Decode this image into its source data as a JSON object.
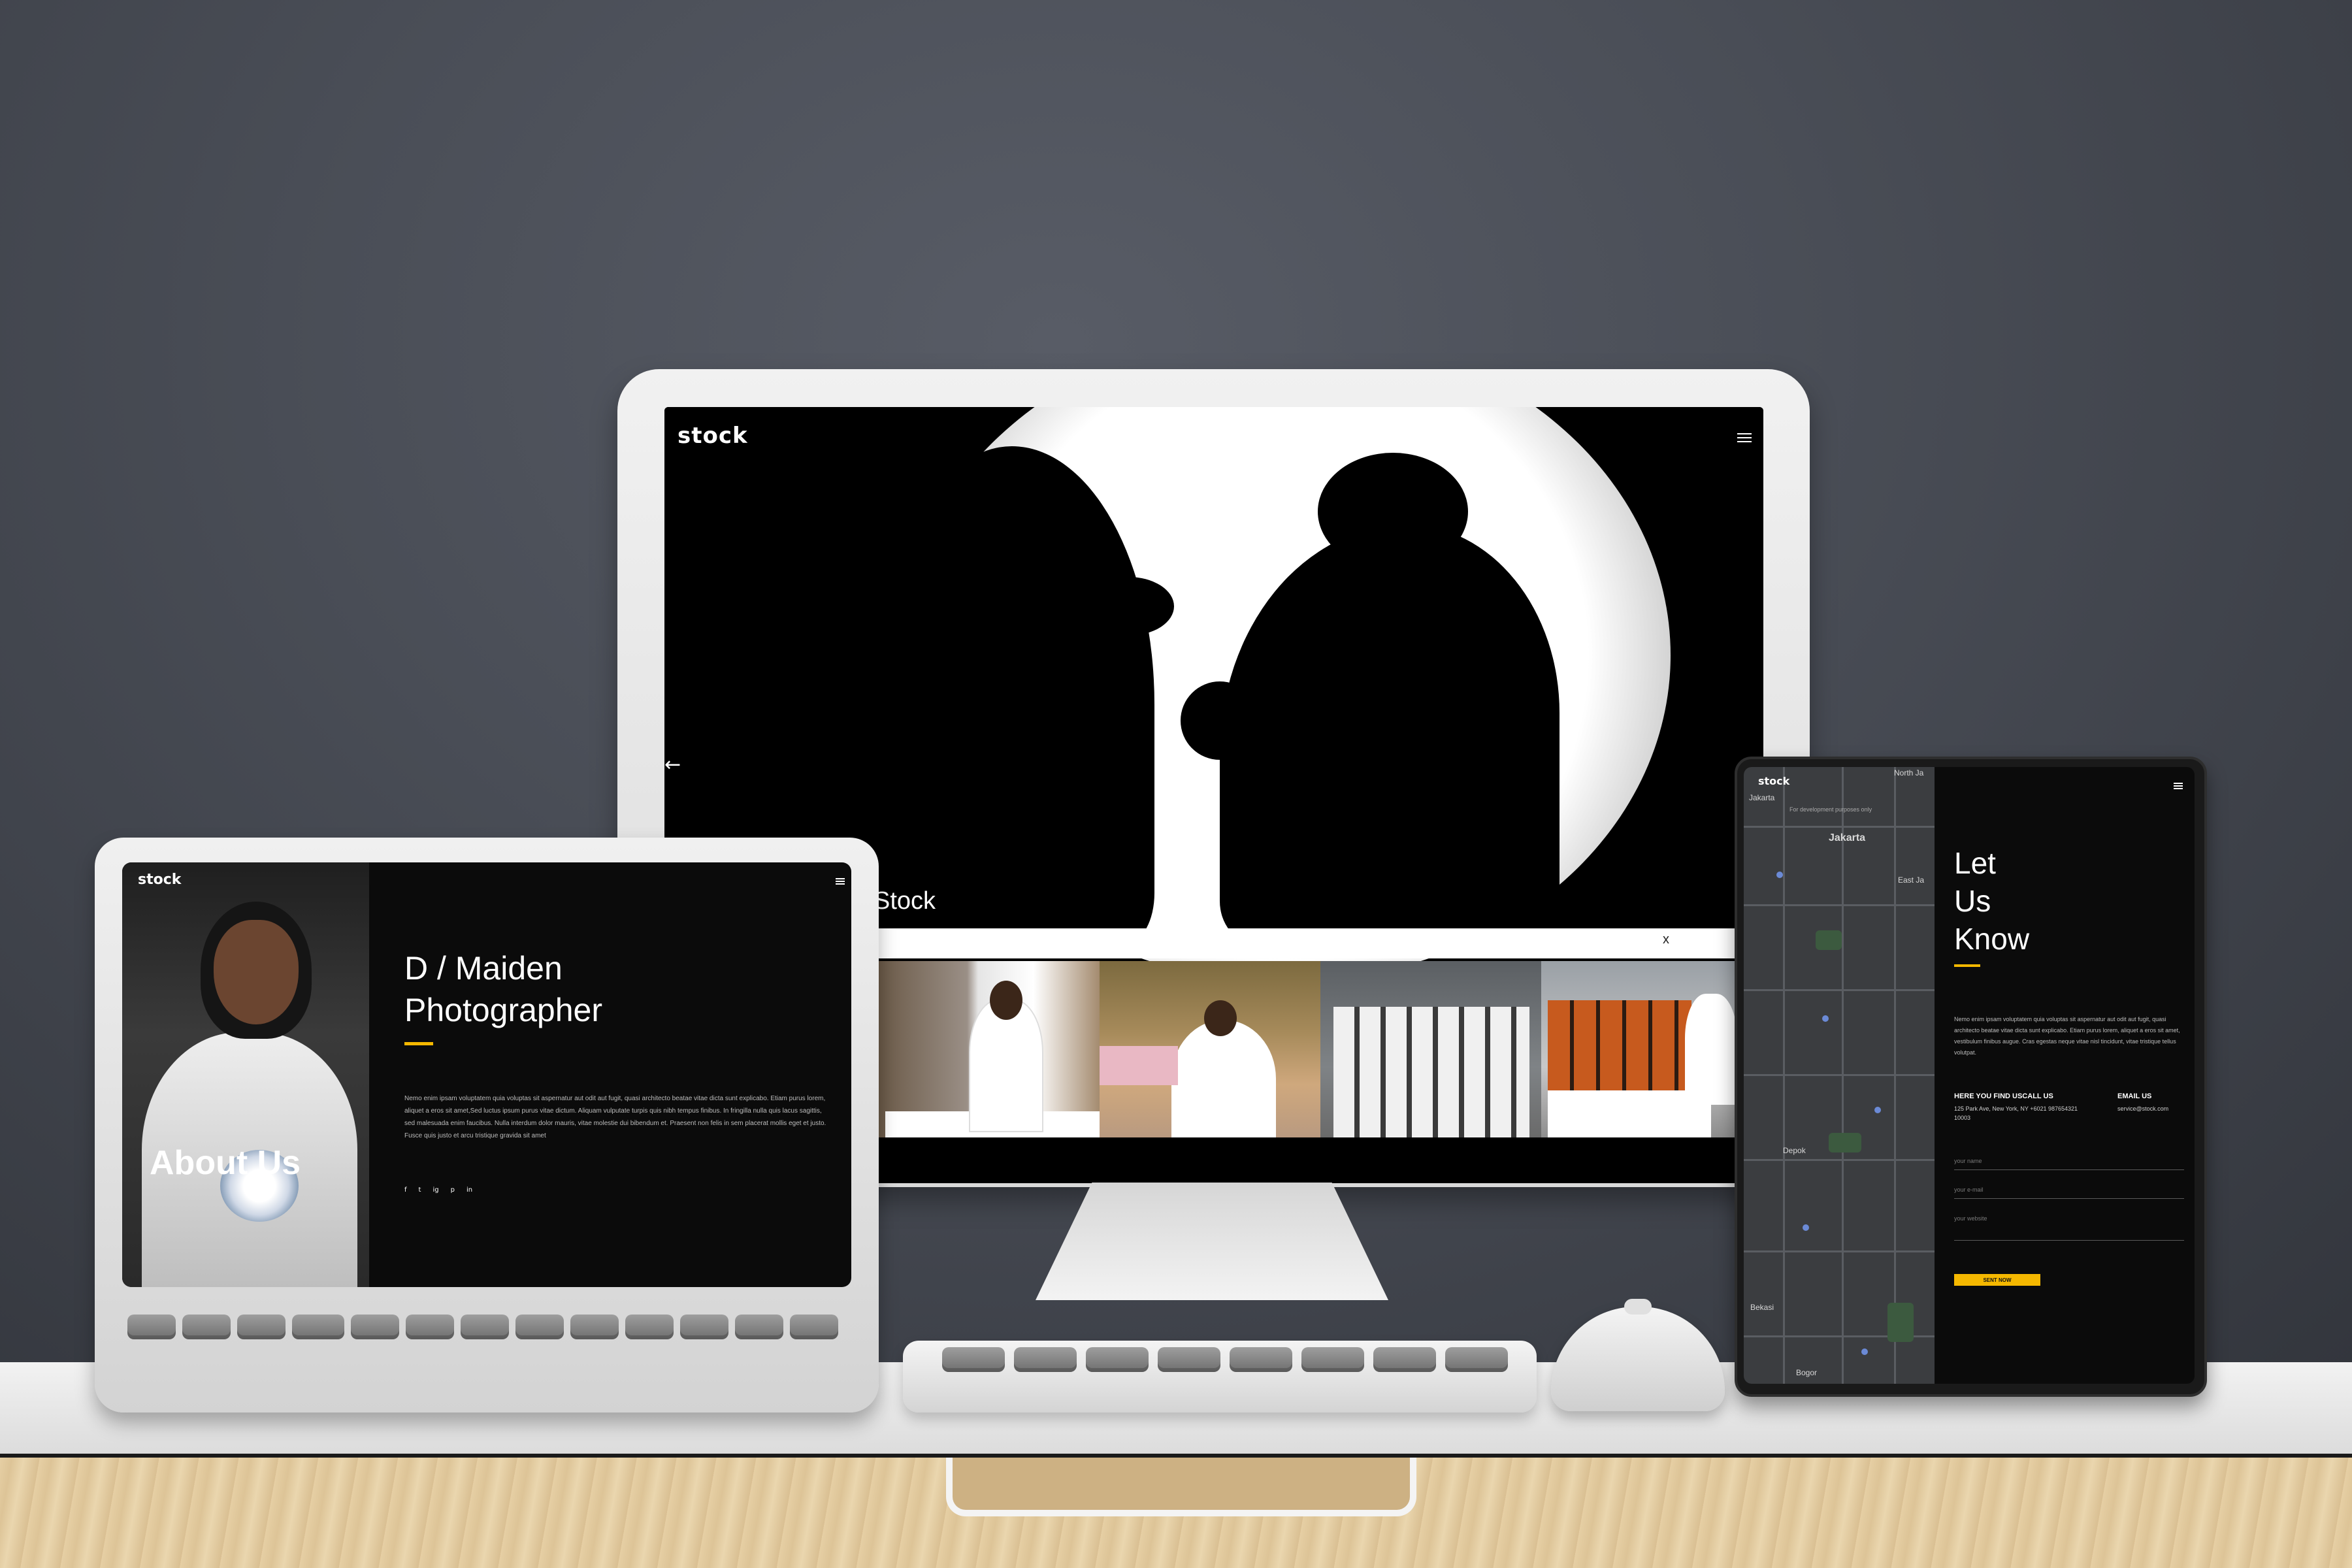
{
  "monitor": {
    "logo": "stock",
    "hero_brand": "Stock",
    "gallery_close": "x",
    "prev_arrow": "←",
    "menu_icon": "hamburger-icon"
  },
  "laptop": {
    "logo": "stock",
    "about_title": "About Us",
    "heading_line1": "D / Maiden",
    "heading_line2": "Photographer",
    "body": "Nemo enim ipsam voluptatem quia voluptas sit aspernatur aut odit aut fugit, quasi architecto beatae vitae dicta sunt explicabo. Etiam purus lorem, aliquet a eros sit amet,Sed luctus ipsum purus vitae dictum. Aliquam vulputate turpis quis nibh tempus finibus. In fringilla nulla quis lacus sagittis, sed malesuada enim faucibus. Nulla interdum dolor mauris, vitae molestie dui bibendum et. Praesent non felis in sem placerat mollis eget et justo. Fusce quis justo et arcu tristique gravida sit amet",
    "social": [
      "f",
      "t",
      "ig",
      "p",
      "in"
    ],
    "accent": "#f5b800"
  },
  "tablet": {
    "logo": "stock",
    "title_line1": "Let",
    "title_line2": "Us",
    "title_line3": "Know",
    "body": "Nemo enim ipsam voluptatem quia voluptas sit aspernatur aut odit aut fugit, quasi architecto beatae vitae dicta sunt explicabo. Etiam purus lorem, aliquet a eros sit amet, vestibulum finibus augue. Cras egestas neque vitae nisl tincidunt, vitae tristique tellus volutpat.",
    "find_heading": "HERE YOU FIND USCALL US",
    "find_text": "125 Park Ave, New York, NY +6021 987654321 10003",
    "email_heading": "EMAIL US",
    "email_text": "service@stock.com",
    "name_placeholder": "your name",
    "email_placeholder": "your e-mail",
    "website_placeholder": "your website",
    "send_label": "SENT NOW",
    "map_labels": [
      "Jakarta",
      "Jakarta",
      "Depok",
      "Bogor",
      "Bekasi",
      "North Ja",
      "East Ja",
      "For development purposes only"
    ],
    "accent": "#f5b800"
  }
}
